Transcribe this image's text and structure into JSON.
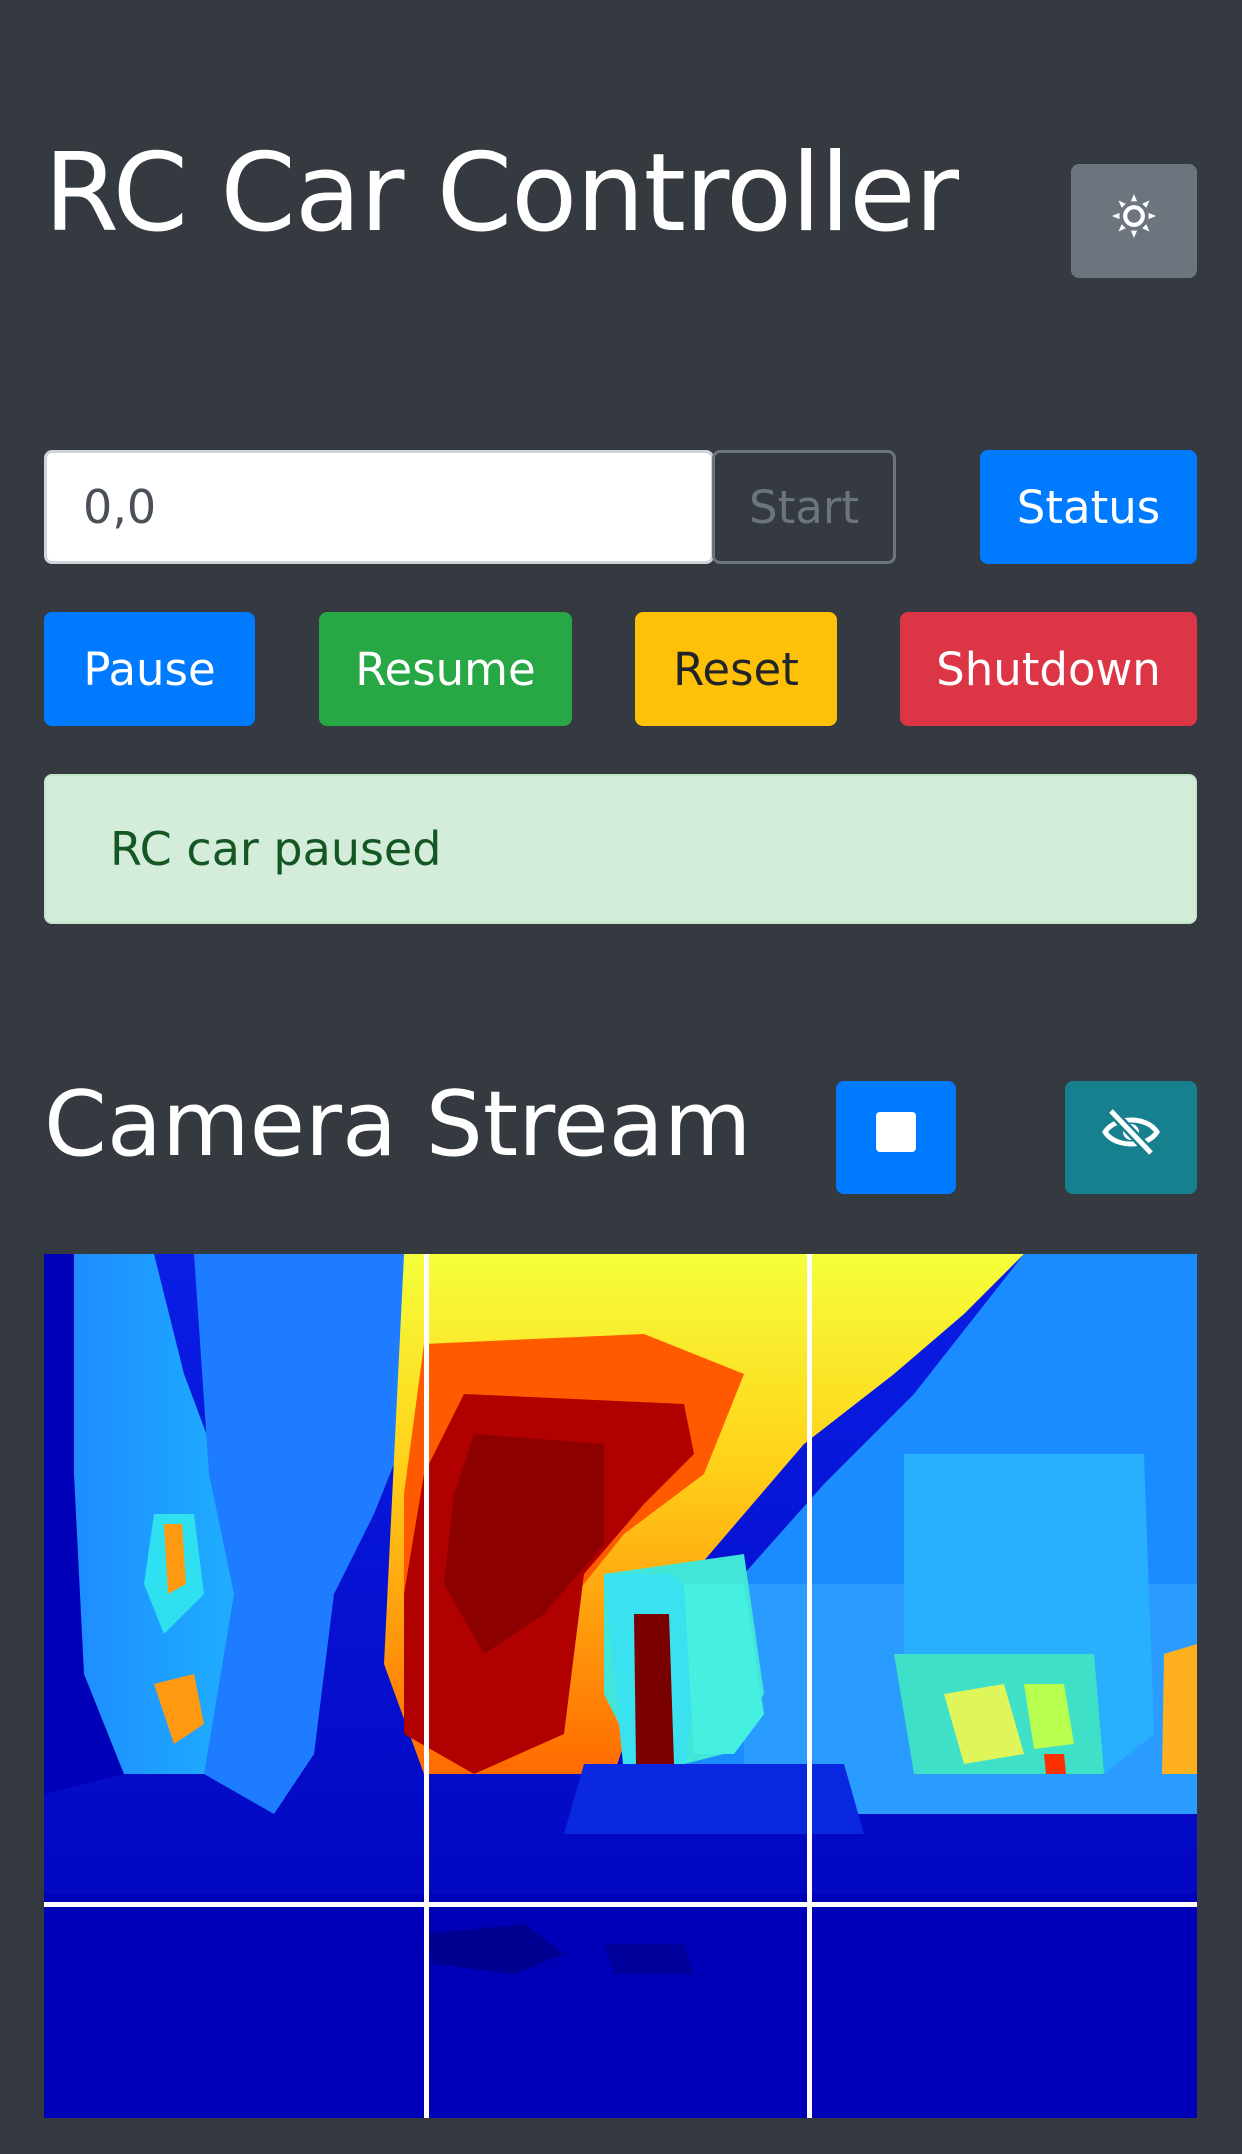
{
  "header": {
    "title": "RC Car Controller",
    "theme_toggle_icon": "sun-icon"
  },
  "controls": {
    "coordinate_input_value": "0,0",
    "start_label": "Start",
    "status_label": "Status",
    "pause_label": "Pause",
    "resume_label": "Resume",
    "reset_label": "Reset",
    "shutdown_label": "Shutdown"
  },
  "alert": {
    "message": "RC car paused"
  },
  "camera": {
    "title": "Camera Stream",
    "stop_icon": "stop-icon",
    "hide_icon": "eye-slash-icon",
    "view": "depth-colormap"
  },
  "colors": {
    "background": "#343a40",
    "primary": "#007bff",
    "success": "#28a745",
    "warning": "#ffc107",
    "danger": "#dc3545",
    "secondary": "#6c757d",
    "info": "#17808e",
    "alert_bg": "#d4edda",
    "alert_text": "#155724"
  }
}
